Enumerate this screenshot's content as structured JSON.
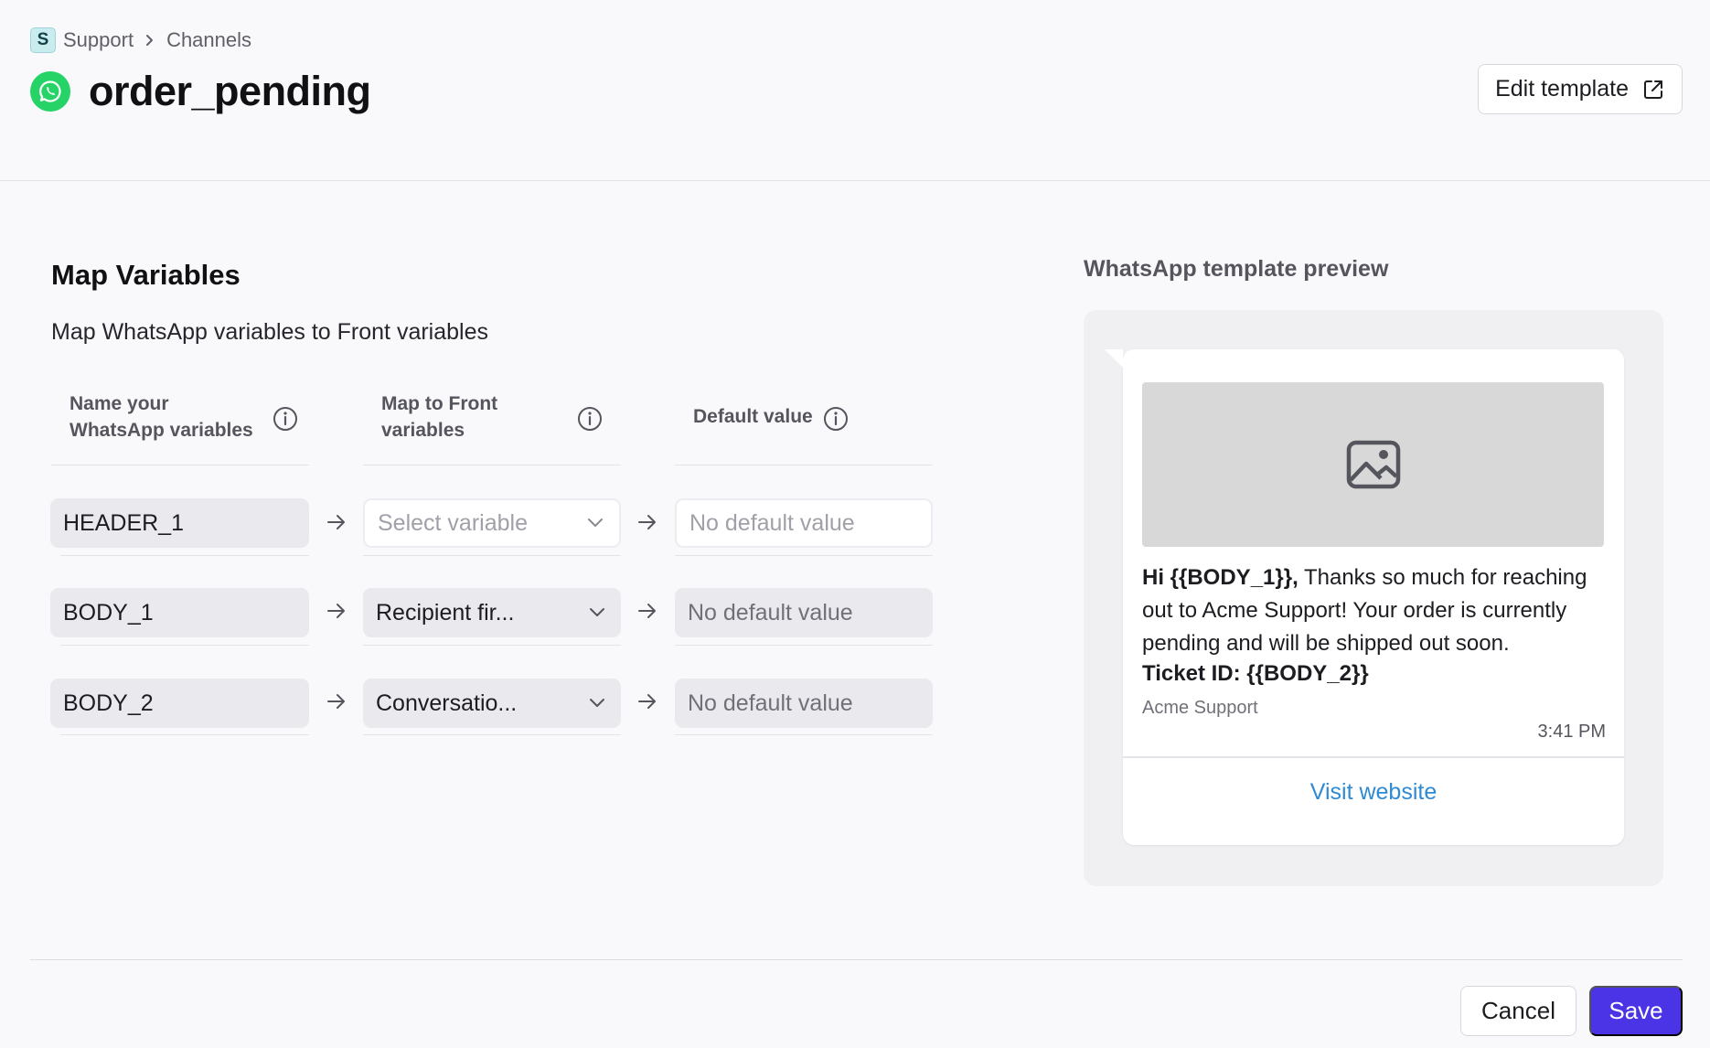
{
  "breadcrumb": {
    "workspace_initial": "S",
    "workspace": "Support",
    "section": "Channels"
  },
  "header": {
    "title": "order_pending",
    "edit_button": "Edit template"
  },
  "mapping": {
    "title": "Map Variables",
    "description": "Map WhatsApp variables to Front variables",
    "columns": {
      "name_line1": "Name your",
      "name_line2": "WhatsApp variables",
      "map_line1": "Map to Front",
      "map_line2": "variables",
      "default": "Default value"
    },
    "rows": [
      {
        "name": "HEADER_1",
        "front_variable": "Select variable",
        "default_placeholder": "No default value"
      },
      {
        "name": "BODY_1",
        "front_variable": "Recipient fir...",
        "default_placeholder": "No default value"
      },
      {
        "name": "BODY_2",
        "front_variable": "Conversatio...",
        "default_placeholder": "No default value"
      }
    ]
  },
  "preview": {
    "title": "WhatsApp template preview",
    "greeting": "Hi {{BODY_1}},",
    "body": "Thanks so much for reaching out to Acme Support! Your order is currently pending and will be shipped out soon.",
    "ticket": "Ticket ID: {{BODY_2}}",
    "footer": "Acme Support",
    "time": "3:41 PM",
    "button": "Visit website"
  },
  "actions": {
    "cancel": "Cancel",
    "save": "Save"
  },
  "colors": {
    "primary": "#4b33e6",
    "whatsapp": "#25d366",
    "link": "#2f8ad4"
  }
}
